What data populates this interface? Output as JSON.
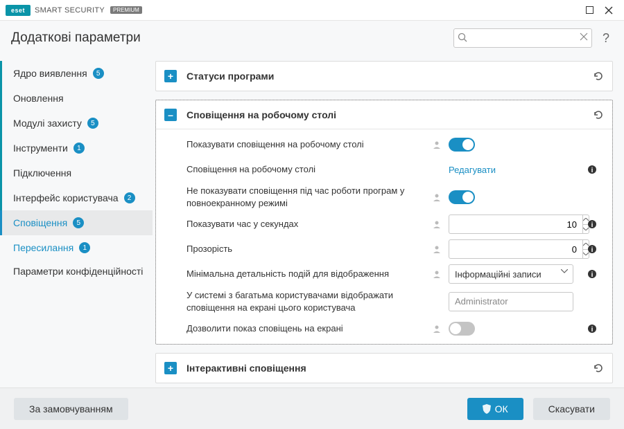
{
  "titlebar": {
    "brand_logo": "eset",
    "brand_text": "SMART SECURITY",
    "brand_badge": "PREMIUM"
  },
  "header": {
    "title": "Додаткові параметри",
    "search_placeholder": "",
    "help": "?"
  },
  "sidebar": {
    "items": [
      {
        "label": "Ядро виявлення",
        "badge": "5",
        "active": true
      },
      {
        "label": "Оновлення",
        "badge": "",
        "active": true
      },
      {
        "label": "Модулі захисту",
        "badge": "5",
        "active": true
      },
      {
        "label": "Інструменти",
        "badge": "1",
        "active": true
      },
      {
        "label": "Підключення",
        "badge": "",
        "active": true
      },
      {
        "label": "Інтерфейс користувача",
        "badge": "2",
        "active": true
      },
      {
        "label": "Сповіщення",
        "badge": "5",
        "selected": true,
        "sub": true
      },
      {
        "label": "Пересилання",
        "badge": "1",
        "sub": true
      },
      {
        "label": "Параметри конфіденційності",
        "badge": "",
        "multiline": true
      }
    ]
  },
  "panels": {
    "p0": {
      "title": "Статуси програми",
      "expanded": false
    },
    "p1": {
      "title": "Сповіщення на робочому столі",
      "expanded": true,
      "rows": {
        "show_desktop": {
          "label": "Показувати сповіщення на робочому столі",
          "on": true
        },
        "desktop_link": {
          "label": "Сповіщення на робочому столі",
          "link": "Редагувати"
        },
        "fullscreen": {
          "label": "Не показувати сповіщення під час роботи програм у повноекранному режимі",
          "on": true
        },
        "seconds": {
          "label": "Показувати час у секундах",
          "value": "10"
        },
        "opacity": {
          "label": "Прозорість",
          "value": "0"
        },
        "verbosity": {
          "label": "Мінімальна детальність подій для відображення",
          "value": "Інформаційні записи"
        },
        "multiuser": {
          "label": "У системі з багатьма користувачами відображати сповіщення на екрані цього користувача",
          "value": "Administrator"
        },
        "allow_screen": {
          "label": "Дозволити показ сповіщень на екрані",
          "on": false
        }
      }
    },
    "p2": {
      "title": "Інтерактивні сповіщення",
      "expanded": false
    }
  },
  "footer": {
    "defaults": "За замовчуванням",
    "ok": "ОК",
    "cancel": "Скасувати"
  }
}
